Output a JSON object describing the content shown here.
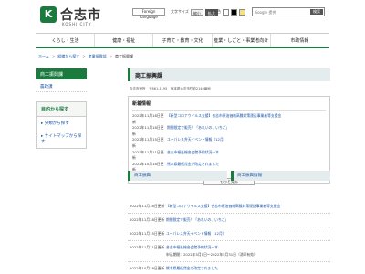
{
  "header": {
    "logo_mark": "K",
    "logo_text": "合志市",
    "logo_sub": "KOSHI CITY",
    "foreign_language": "Foreign Language",
    "text_size_label": "文字サイズ",
    "text_size_small": "縮小",
    "text_size_large": "拡大",
    "bg_color_label": "背景色",
    "bg_colors": [
      "#ffffff",
      "#000000",
      "#f4e27a"
    ],
    "search_placeholder": "Google 提供",
    "search_button": "検索"
  },
  "gnav": [
    "くらし・生活",
    "健康・福祉",
    "子育て・教育・文化",
    "産業・しごと・事業者向け",
    "市政情報"
  ],
  "breadcrumb": [
    "ホーム",
    "組織から探す",
    "産業振興部",
    "商工振興課"
  ],
  "sidebar": {
    "heading": "商工振興課",
    "link": "農政課",
    "search_box_title": "目的から探す",
    "search_links": [
      "分類から探す",
      "サイトマップから探す"
    ]
  },
  "main": {
    "title": "商工振興課",
    "address": "合志市役所　〒861-1195　熊本県合志市竹迫2140番地",
    "news_title": "新着情報",
    "news": [
      {
        "date": "2022年11月18日更新",
        "text": "【新型コロナウイルス支援】合志市原油価格高騰対策運送事業者等支援金"
      },
      {
        "date": "2022年11月18日更新",
        "text": "期間限定で販売！「あれいの、いちご」"
      },
      {
        "date": "2022年11月15日更新",
        "text": "ユーパレス弁天イベント情報（12月）"
      },
      {
        "date": "2022年11月11日更新",
        "text": "合志市福祉総合会館予約状況一本"
      },
      {
        "date": "2022年10月18日更新",
        "text": "熊本県最低賃金が改定されました"
      }
    ],
    "more_button": "もっと見る",
    "section_tabs": [
      "商工振興",
      "商工振興情報"
    ]
  },
  "list": [
    {
      "date": "2022年11月18日更新",
      "text": "【新型コロナウイルス支援】合志市原油価格高騰対策運送事業者等支援金",
      "sub": ""
    },
    {
      "date": "2022年11月18日更新",
      "text": "期間限定で販売！「あれいの、いちご」",
      "sub": ""
    },
    {
      "date": "2022年11月15日更新",
      "text": "ユーパレス弁天イベント情報（12月）",
      "sub": ""
    },
    {
      "date": "2022年11月11日更新",
      "text": "合志市福祉総合会館予約状況一本",
      "sub": "申込期間：2022年5月1日～2022年5月31日（消印有効）"
    },
    {
      "date": "2022年10月18日更新",
      "text": "熊本県最低賃金が改定されました",
      "sub": ""
    }
  ]
}
